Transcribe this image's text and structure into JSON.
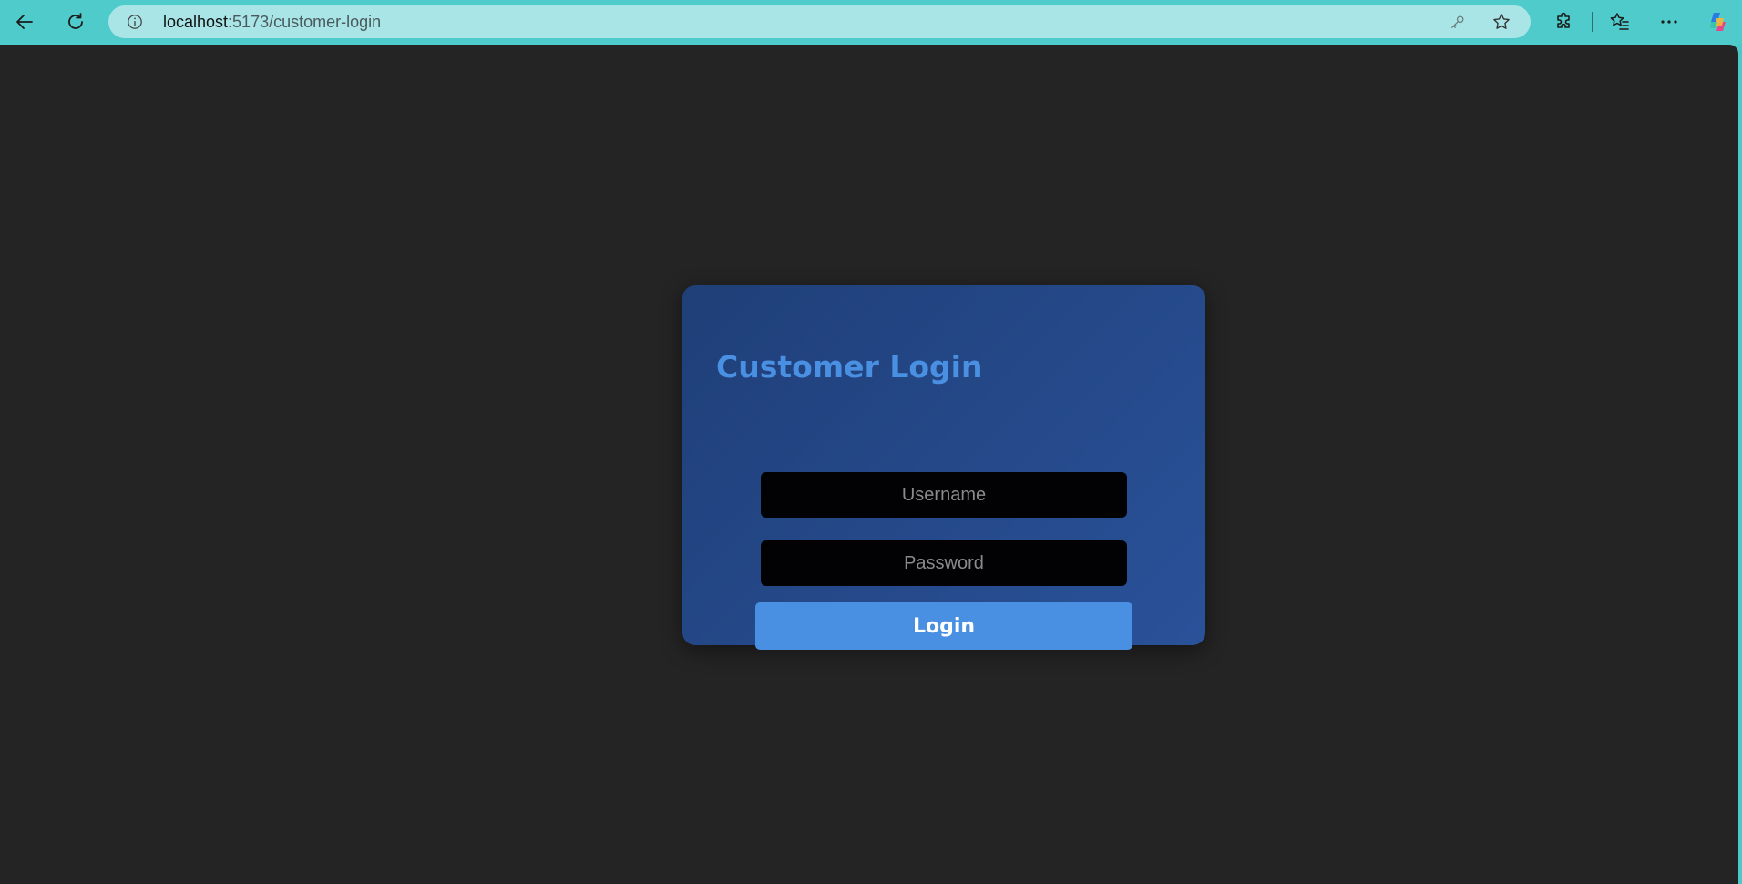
{
  "browser": {
    "url_host": "localhost",
    "url_path": ":5173/customer-login",
    "icons": {
      "back": "back-arrow-icon",
      "refresh": "refresh-icon",
      "info": "info-icon",
      "key": "key-icon",
      "favorite": "star-icon",
      "extensions": "puzzle-icon",
      "favorites_bar": "favorites-list-icon",
      "more": "more-dots-icon",
      "copilot": "copilot-icon"
    },
    "colors": {
      "toolbar": "#4ecbca",
      "address_bar": "#a9e5e6"
    }
  },
  "page": {
    "background": "#242424",
    "login": {
      "title": "Customer Login",
      "username_placeholder": "Username",
      "password_placeholder": "Password",
      "submit_label": "Login"
    },
    "colors": {
      "card": "#25498a",
      "title": "#4a90e2",
      "input": "#020205",
      "button": "#4a90e2",
      "button_text": "#ffffff"
    }
  }
}
